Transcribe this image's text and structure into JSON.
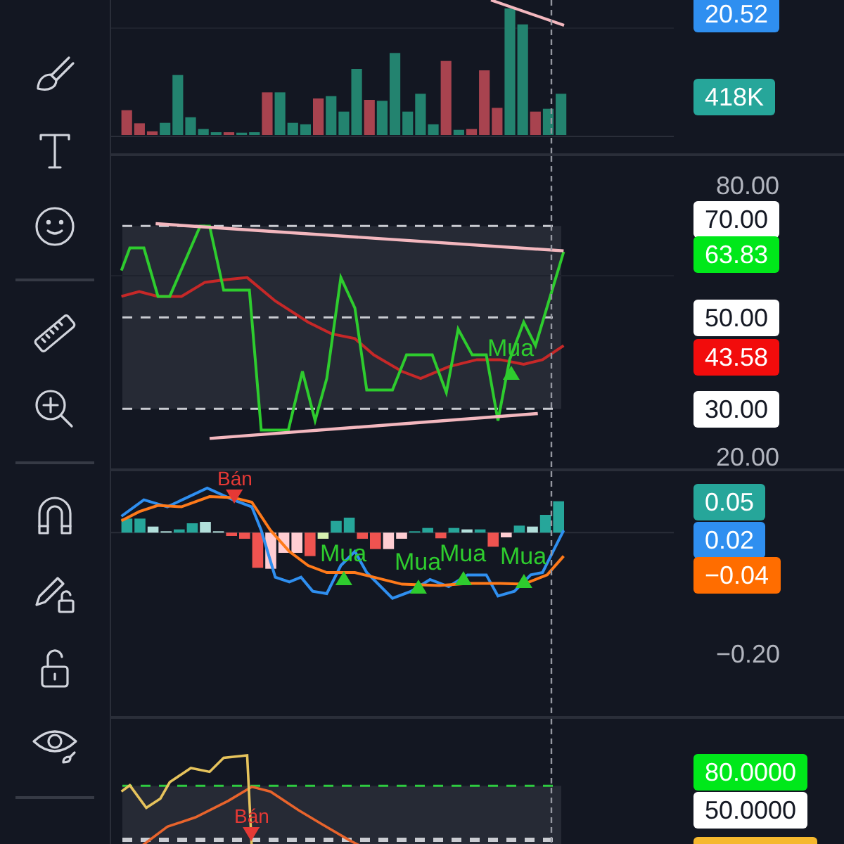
{
  "panes": [
    {
      "kind": "volume",
      "axis": [
        {
          "text": "20.52",
          "kind": "badge",
          "color": "#2f8ff0"
        },
        {
          "text": "418K",
          "kind": "badge",
          "color": "#26a69a"
        }
      ]
    },
    {
      "kind": "rsi",
      "axis": [
        {
          "text": "80.00",
          "kind": "tick"
        },
        {
          "text": "70.00",
          "kind": "badge",
          "color": "#ffffff"
        },
        {
          "text": "63.83",
          "kind": "badge",
          "color": "#00e81a"
        },
        {
          "text": "50.00",
          "kind": "badge",
          "color": "#ffffff"
        },
        {
          "text": "43.58",
          "kind": "badge",
          "color": "#f20c0c"
        },
        {
          "text": "30.00",
          "kind": "badge",
          "color": "#ffffff"
        },
        {
          "text": "20.00",
          "kind": "tick"
        }
      ],
      "signals": [
        {
          "text": "Mua",
          "kind": "buy"
        }
      ]
    },
    {
      "kind": "macd",
      "axis": [
        {
          "text": "0.05",
          "kind": "badge",
          "color": "#26a69a"
        },
        {
          "text": "0.02",
          "kind": "badge",
          "color": "#2f8ff0"
        },
        {
          "text": "−0.04",
          "kind": "badge",
          "color": "#ff6d00"
        },
        {
          "text": "−0.20",
          "kind": "tick"
        }
      ],
      "signals": [
        {
          "text": "Bán",
          "kind": "sell"
        },
        {
          "text": "Mua",
          "kind": "buy"
        },
        {
          "text": "Mua",
          "kind": "buy"
        },
        {
          "text": "Mua",
          "kind": "buy"
        },
        {
          "text": "Mua",
          "kind": "buy"
        }
      ]
    },
    {
      "kind": "stochastic",
      "axis": [
        {
          "text": "80.0000",
          "kind": "badge",
          "color": "#00e81a"
        },
        {
          "text": "50.0000",
          "kind": "badge",
          "color": "#ffffff"
        }
      ],
      "signals": [
        {
          "text": "Bán",
          "kind": "sell"
        }
      ]
    }
  ]
}
